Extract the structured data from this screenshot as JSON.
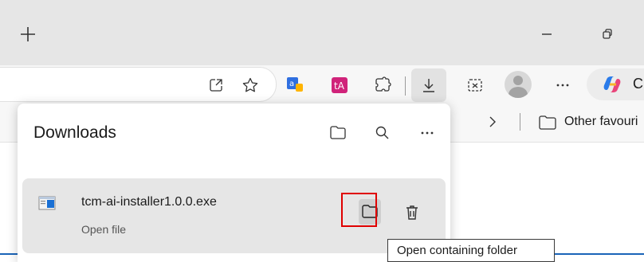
{
  "titlebar": {
    "new_tab_icon": "plus-icon",
    "minimize_icon": "minimize-icon",
    "restore_icon": "restore-icon"
  },
  "toolbar": {
    "icons": [
      "open-in-app-icon",
      "favorite-star-icon",
      "translate-extension-icon",
      "text-extension-icon",
      "extensions-icon",
      "download-icon",
      "screenshot-icon",
      "profile-icon",
      "more-icon",
      "copilot-icon"
    ],
    "copilot_label": "C"
  },
  "favorites_bar": {
    "other_favorites_label": "Other favouri"
  },
  "downloads": {
    "title": "Downloads",
    "items": [
      {
        "file_name": "tcm-ai-installer1.0.0.exe",
        "action_label": "Open file"
      }
    ],
    "tooltip": "Open containing folder"
  },
  "colors": {
    "highlight": "#e00000",
    "accent": "#1a64b8"
  }
}
